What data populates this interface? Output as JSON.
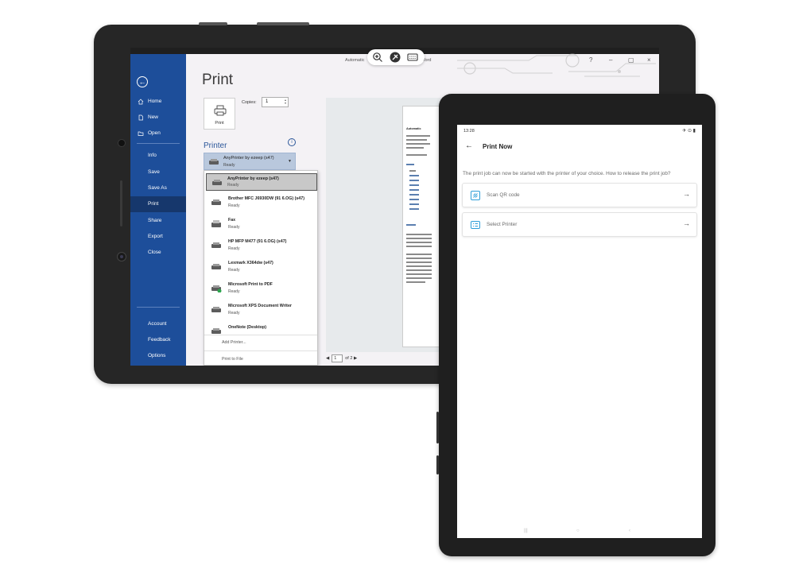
{
  "word": {
    "title_left": "Automatic",
    "title_right": "- Word",
    "window_controls": {
      "help": "?",
      "minimize": "–",
      "maximize": "▢",
      "close": "×"
    },
    "sidebar": {
      "back_label": "←",
      "items_top": [
        {
          "label": "Home",
          "icon": "home-icon"
        },
        {
          "label": "New",
          "icon": "new-doc-icon"
        },
        {
          "label": "Open",
          "icon": "folder-icon"
        }
      ],
      "items_mid": [
        "Info",
        "Save",
        "Save As",
        "Print",
        "Share",
        "Export",
        "Close"
      ],
      "active": "Print",
      "items_bottom": [
        "Account",
        "Feedback",
        "Options"
      ]
    },
    "page_title": "Print",
    "print_button": "Print",
    "copies_label": "Copies:",
    "copies_value": "1",
    "printer_heading": "Printer",
    "info_glyph": "i",
    "selected_printer": {
      "name": "AnyPrinter by ezeep (s47)",
      "status": "Ready"
    },
    "printers": [
      {
        "name": "AnyPrinter by ezeep (s47)",
        "status": "Ready",
        "selected": true
      },
      {
        "name": "Brother MFC J6930DW (91 6.OG) (s47)",
        "status": "Ready"
      },
      {
        "name": "Fax",
        "status": "Ready"
      },
      {
        "name": "HP MFP M477 (91 6.OG) (s47)",
        "status": "Ready"
      },
      {
        "name": "Lexmark X364dw (s47)",
        "status": "Ready"
      },
      {
        "name": "Microsoft Print to PDF",
        "status": "Ready"
      },
      {
        "name": "Microsoft XPS Document Writer",
        "status": "Ready"
      },
      {
        "name": "OneNote (Desktop)",
        "status": ""
      }
    ],
    "add_printer": "Add Printer...",
    "print_to_file": "Print to File",
    "preview": {
      "doc_title": "Automatic",
      "page_current": "1",
      "page_total_label": "of 2"
    }
  },
  "app": {
    "status_time": "13:28",
    "status_icons_right": "✈ ⊙ ▮",
    "title": "Print Now",
    "back_glyph": "←",
    "description": "The print job can now be started with the printer of your choice. How to release the print job?",
    "options": [
      {
        "label": "Scan QR code",
        "icon": "qr-scan-icon"
      },
      {
        "label": "Select Printer",
        "icon": "printer-list-icon"
      }
    ],
    "arrow_glyph": "→",
    "accent_color": "#2f9fd8"
  }
}
